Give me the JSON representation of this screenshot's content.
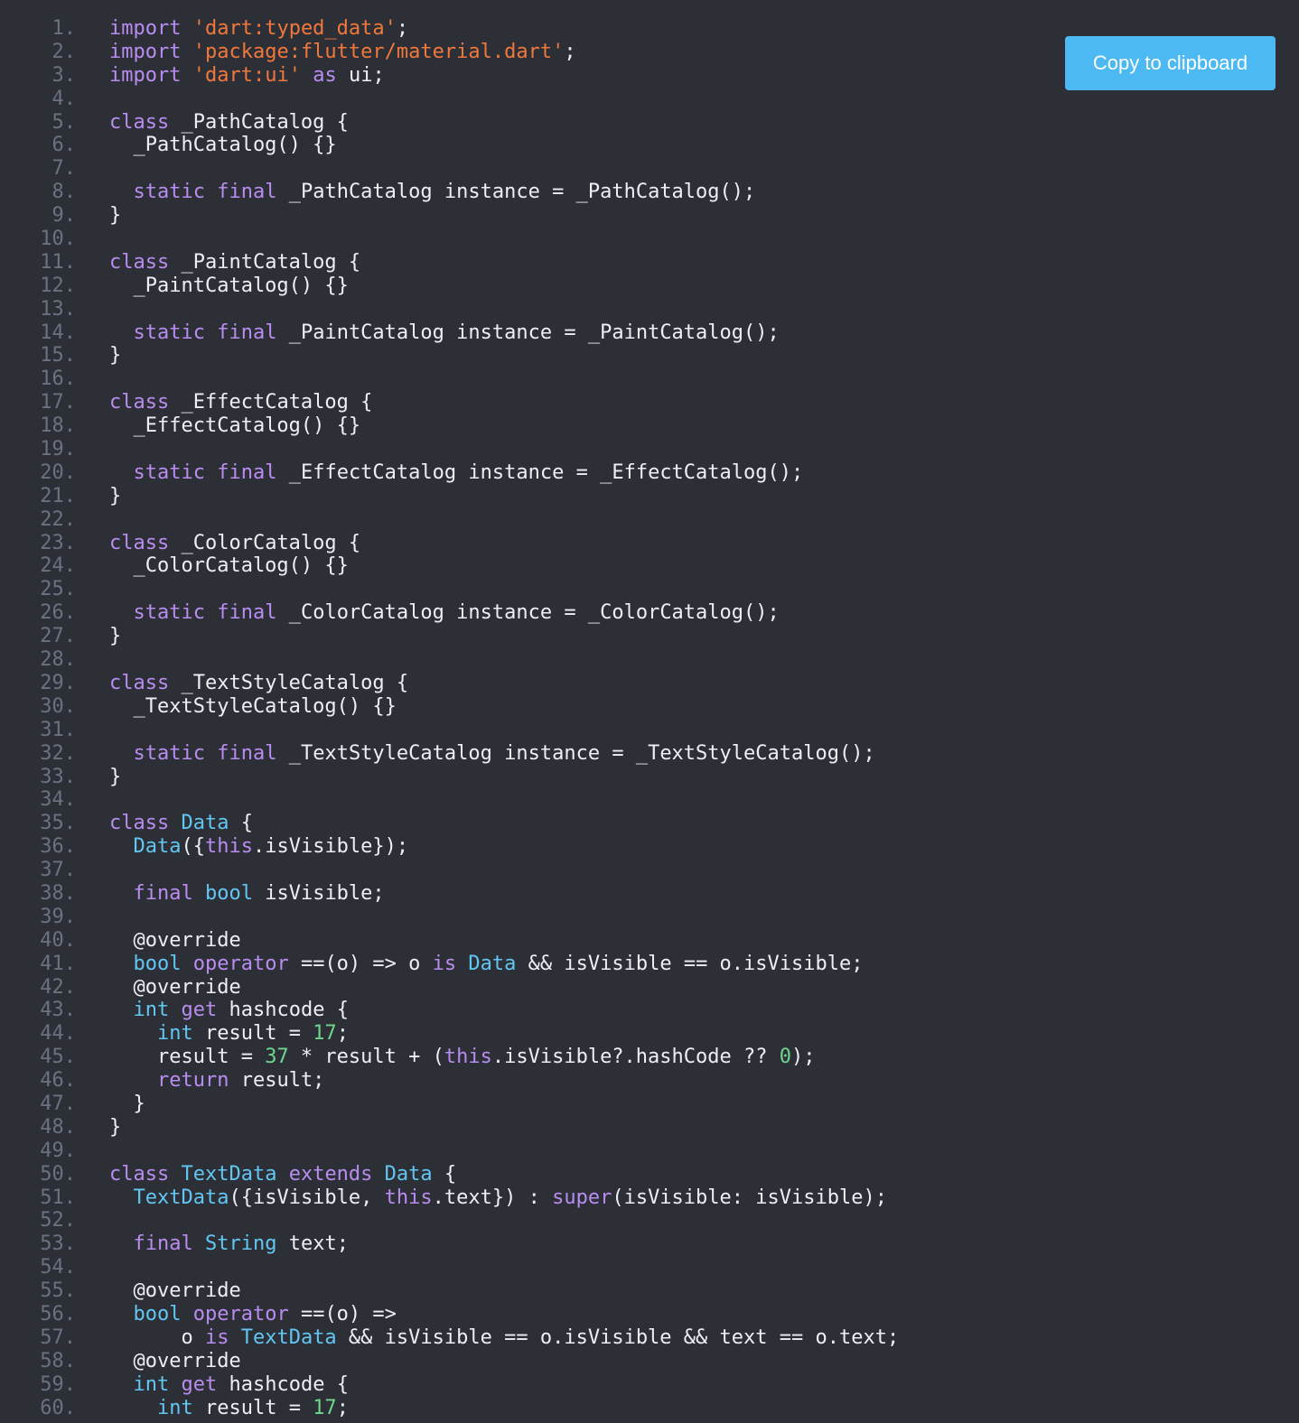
{
  "colors": {
    "background": "#2d2f37",
    "line_number": "#6b7180",
    "keyword": "#b98cf0",
    "type": "#62c6f2",
    "string": "#f0783c",
    "number": "#6ed58e",
    "plain": "#eceff4",
    "copy_button": "#4cb9f3"
  },
  "copy_button": {
    "label": "Copy to clipboard"
  },
  "code": {
    "language": "dart",
    "lines": [
      {
        "n": "1.",
        "tokens": [
          [
            "kw",
            "import"
          ],
          [
            "p",
            " "
          ],
          [
            "s",
            "'dart:typed_data'"
          ],
          [
            "p",
            ";"
          ]
        ]
      },
      {
        "n": "2.",
        "tokens": [
          [
            "kw",
            "import"
          ],
          [
            "p",
            " "
          ],
          [
            "s",
            "'package:flutter/material.dart'"
          ],
          [
            "p",
            ";"
          ]
        ]
      },
      {
        "n": "3.",
        "tokens": [
          [
            "kw",
            "import"
          ],
          [
            "p",
            " "
          ],
          [
            "s",
            "'dart:ui'"
          ],
          [
            "p",
            " "
          ],
          [
            "kw",
            "as"
          ],
          [
            "p",
            " ui;"
          ]
        ]
      },
      {
        "n": "4.",
        "tokens": []
      },
      {
        "n": "5.",
        "tokens": [
          [
            "kw",
            "class"
          ],
          [
            "p",
            " _PathCatalog {"
          ]
        ]
      },
      {
        "n": "6.",
        "tokens": [
          [
            "p",
            "  _PathCatalog() {}"
          ]
        ]
      },
      {
        "n": "7.",
        "tokens": []
      },
      {
        "n": "8.",
        "tokens": [
          [
            "p",
            "  "
          ],
          [
            "kw",
            "static"
          ],
          [
            "p",
            " "
          ],
          [
            "kw",
            "final"
          ],
          [
            "p",
            " _PathCatalog instance = _PathCatalog();"
          ]
        ]
      },
      {
        "n": "9.",
        "tokens": [
          [
            "p",
            "}"
          ]
        ]
      },
      {
        "n": "10.",
        "tokens": []
      },
      {
        "n": "11.",
        "tokens": [
          [
            "kw",
            "class"
          ],
          [
            "p",
            " _PaintCatalog {"
          ]
        ]
      },
      {
        "n": "12.",
        "tokens": [
          [
            "p",
            "  _PaintCatalog() {}"
          ]
        ]
      },
      {
        "n": "13.",
        "tokens": []
      },
      {
        "n": "14.",
        "tokens": [
          [
            "p",
            "  "
          ],
          [
            "kw",
            "static"
          ],
          [
            "p",
            " "
          ],
          [
            "kw",
            "final"
          ],
          [
            "p",
            " _PaintCatalog instance = _PaintCatalog();"
          ]
        ]
      },
      {
        "n": "15.",
        "tokens": [
          [
            "p",
            "}"
          ]
        ]
      },
      {
        "n": "16.",
        "tokens": []
      },
      {
        "n": "17.",
        "tokens": [
          [
            "kw",
            "class"
          ],
          [
            "p",
            " _EffectCatalog {"
          ]
        ]
      },
      {
        "n": "18.",
        "tokens": [
          [
            "p",
            "  _EffectCatalog() {}"
          ]
        ]
      },
      {
        "n": "19.",
        "tokens": []
      },
      {
        "n": "20.",
        "tokens": [
          [
            "p",
            "  "
          ],
          [
            "kw",
            "static"
          ],
          [
            "p",
            " "
          ],
          [
            "kw",
            "final"
          ],
          [
            "p",
            " _EffectCatalog instance = _EffectCatalog();"
          ]
        ]
      },
      {
        "n": "21.",
        "tokens": [
          [
            "p",
            "}"
          ]
        ]
      },
      {
        "n": "22.",
        "tokens": []
      },
      {
        "n": "23.",
        "tokens": [
          [
            "kw",
            "class"
          ],
          [
            "p",
            " _ColorCatalog {"
          ]
        ]
      },
      {
        "n": "24.",
        "tokens": [
          [
            "p",
            "  _ColorCatalog() {}"
          ]
        ]
      },
      {
        "n": "25.",
        "tokens": []
      },
      {
        "n": "26.",
        "tokens": [
          [
            "p",
            "  "
          ],
          [
            "kw",
            "static"
          ],
          [
            "p",
            " "
          ],
          [
            "kw",
            "final"
          ],
          [
            "p",
            " _ColorCatalog instance = _ColorCatalog();"
          ]
        ]
      },
      {
        "n": "27.",
        "tokens": [
          [
            "p",
            "}"
          ]
        ]
      },
      {
        "n": "28.",
        "tokens": []
      },
      {
        "n": "29.",
        "tokens": [
          [
            "kw",
            "class"
          ],
          [
            "p",
            " _TextStyleCatalog {"
          ]
        ]
      },
      {
        "n": "30.",
        "tokens": [
          [
            "p",
            "  _TextStyleCatalog() {}"
          ]
        ]
      },
      {
        "n": "31.",
        "tokens": []
      },
      {
        "n": "32.",
        "tokens": [
          [
            "p",
            "  "
          ],
          [
            "kw",
            "static"
          ],
          [
            "p",
            " "
          ],
          [
            "kw",
            "final"
          ],
          [
            "p",
            " _TextStyleCatalog instance = _TextStyleCatalog();"
          ]
        ]
      },
      {
        "n": "33.",
        "tokens": [
          [
            "p",
            "}"
          ]
        ]
      },
      {
        "n": "34.",
        "tokens": []
      },
      {
        "n": "35.",
        "tokens": [
          [
            "kw",
            "class"
          ],
          [
            "p",
            " "
          ],
          [
            "t",
            "Data"
          ],
          [
            "p",
            " {"
          ]
        ]
      },
      {
        "n": "36.",
        "tokens": [
          [
            "p",
            "  "
          ],
          [
            "t",
            "Data"
          ],
          [
            "p",
            "({"
          ],
          [
            "kw",
            "this"
          ],
          [
            "p",
            ".isVisible});"
          ]
        ]
      },
      {
        "n": "37.",
        "tokens": []
      },
      {
        "n": "38.",
        "tokens": [
          [
            "p",
            "  "
          ],
          [
            "kw",
            "final"
          ],
          [
            "p",
            " "
          ],
          [
            "t",
            "bool"
          ],
          [
            "p",
            " isVisible;"
          ]
        ]
      },
      {
        "n": "39.",
        "tokens": []
      },
      {
        "n": "40.",
        "tokens": [
          [
            "p",
            "  @override"
          ]
        ]
      },
      {
        "n": "41.",
        "tokens": [
          [
            "p",
            "  "
          ],
          [
            "t",
            "bool"
          ],
          [
            "p",
            " "
          ],
          [
            "kw",
            "operator"
          ],
          [
            "p",
            " ==(o) => o "
          ],
          [
            "kw",
            "is"
          ],
          [
            "p",
            " "
          ],
          [
            "t",
            "Data"
          ],
          [
            "p",
            " && isVisible == o.isVisible;"
          ]
        ]
      },
      {
        "n": "42.",
        "tokens": [
          [
            "p",
            "  @override"
          ]
        ]
      },
      {
        "n": "43.",
        "tokens": [
          [
            "p",
            "  "
          ],
          [
            "t",
            "int"
          ],
          [
            "p",
            " "
          ],
          [
            "kw",
            "get"
          ],
          [
            "p",
            " hashcode {"
          ]
        ]
      },
      {
        "n": "44.",
        "tokens": [
          [
            "p",
            "    "
          ],
          [
            "t",
            "int"
          ],
          [
            "p",
            " result = "
          ],
          [
            "num",
            "17"
          ],
          [
            "p",
            ";"
          ]
        ]
      },
      {
        "n": "45.",
        "tokens": [
          [
            "p",
            "    result = "
          ],
          [
            "num",
            "37"
          ],
          [
            "p",
            " * result + ("
          ],
          [
            "kw",
            "this"
          ],
          [
            "p",
            ".isVisible?.hashCode ?? "
          ],
          [
            "num",
            "0"
          ],
          [
            "p",
            ");"
          ]
        ]
      },
      {
        "n": "46.",
        "tokens": [
          [
            "p",
            "    "
          ],
          [
            "kw",
            "return"
          ],
          [
            "p",
            " result;"
          ]
        ]
      },
      {
        "n": "47.",
        "tokens": [
          [
            "p",
            "  }"
          ]
        ]
      },
      {
        "n": "48.",
        "tokens": [
          [
            "p",
            "}"
          ]
        ]
      },
      {
        "n": "49.",
        "tokens": []
      },
      {
        "n": "50.",
        "tokens": [
          [
            "kw",
            "class"
          ],
          [
            "p",
            " "
          ],
          [
            "t",
            "TextData"
          ],
          [
            "p",
            " "
          ],
          [
            "kw",
            "extends"
          ],
          [
            "p",
            " "
          ],
          [
            "t",
            "Data"
          ],
          [
            "p",
            " {"
          ]
        ]
      },
      {
        "n": "51.",
        "tokens": [
          [
            "p",
            "  "
          ],
          [
            "t",
            "TextData"
          ],
          [
            "p",
            "({isVisible, "
          ],
          [
            "kw",
            "this"
          ],
          [
            "p",
            ".text}) : "
          ],
          [
            "kw",
            "super"
          ],
          [
            "p",
            "(isVisible: isVisible);"
          ]
        ]
      },
      {
        "n": "52.",
        "tokens": []
      },
      {
        "n": "53.",
        "tokens": [
          [
            "p",
            "  "
          ],
          [
            "kw",
            "final"
          ],
          [
            "p",
            " "
          ],
          [
            "t",
            "String"
          ],
          [
            "p",
            " text;"
          ]
        ]
      },
      {
        "n": "54.",
        "tokens": []
      },
      {
        "n": "55.",
        "tokens": [
          [
            "p",
            "  @override"
          ]
        ]
      },
      {
        "n": "56.",
        "tokens": [
          [
            "p",
            "  "
          ],
          [
            "t",
            "bool"
          ],
          [
            "p",
            " "
          ],
          [
            "kw",
            "operator"
          ],
          [
            "p",
            " ==(o) =>"
          ]
        ]
      },
      {
        "n": "57.",
        "tokens": [
          [
            "p",
            "      o "
          ],
          [
            "kw",
            "is"
          ],
          [
            "p",
            " "
          ],
          [
            "t",
            "TextData"
          ],
          [
            "p",
            " && isVisible == o.isVisible && text == o.text;"
          ]
        ]
      },
      {
        "n": "58.",
        "tokens": [
          [
            "p",
            "  @override"
          ]
        ]
      },
      {
        "n": "59.",
        "tokens": [
          [
            "p",
            "  "
          ],
          [
            "t",
            "int"
          ],
          [
            "p",
            " "
          ],
          [
            "kw",
            "get"
          ],
          [
            "p",
            " hashcode {"
          ]
        ]
      },
      {
        "n": "60.",
        "tokens": [
          [
            "p",
            "    "
          ],
          [
            "t",
            "int"
          ],
          [
            "p",
            " result = "
          ],
          [
            "num",
            "17"
          ],
          [
            "p",
            ";"
          ]
        ]
      }
    ]
  }
}
